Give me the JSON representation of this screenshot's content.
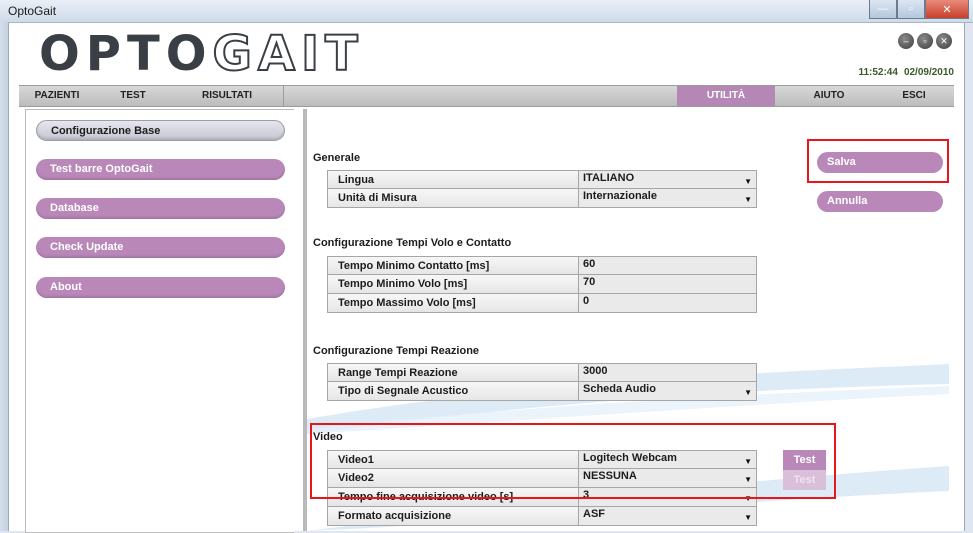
{
  "window": {
    "title": "OptoGait",
    "min_label": "—",
    "max_label": "▫",
    "close_label": "✕"
  },
  "header": {
    "logo_left": "OPTO",
    "logo_right": "GAIT",
    "time": "11:52:44",
    "date": "02/09/2010",
    "circle_icons": [
      "minimize-circle-icon",
      "restore-circle-icon",
      "close-circle-icon"
    ]
  },
  "menu": {
    "pazienti": "PAZIENTI",
    "test": "TEST",
    "risultati": "RISULTATI",
    "utilita": "UTILITÀ",
    "aiuto": "AIUTO",
    "esci": "ESCI"
  },
  "sidebar": {
    "items": [
      "Configurazione Base",
      "Test barre OptoGait",
      "Database",
      "Check Update",
      "About"
    ],
    "selected": "Configurazione Base"
  },
  "general": {
    "title": "Generale",
    "lingua_label": "Lingua",
    "lingua_value": "ITALIANO",
    "unita_label": "Unità di Misura",
    "unita_value": "Internazionale"
  },
  "tempi": {
    "title": "Configurazione Tempi Volo e Contatto",
    "min_contatto_label": "Tempo Minimo Contatto [ms]",
    "min_contatto_value": "60",
    "min_volo_label": "Tempo Minimo Volo [ms]",
    "min_volo_value": "70",
    "max_volo_label": "Tempo Massimo Volo [ms]",
    "max_volo_value": "0"
  },
  "reazione": {
    "title": "Configurazione Tempi Reazione",
    "range_label": "Range Tempi Reazione",
    "range_value": "3000",
    "segnale_label": "Tipo di Segnale Acustico",
    "segnale_value": "Scheda Audio"
  },
  "video": {
    "title": "Video",
    "video1_label": "Video1",
    "video1_value": "Logitech Webcam",
    "video2_label": "Video2",
    "video2_value": "NESSUNA",
    "tempo_fine_label": "Tempo fine acquisizione video [s]",
    "tempo_fine_value": "3",
    "formato_label": "Formato acquisizione",
    "formato_value": "ASF",
    "test_label": "Test"
  },
  "actions": {
    "salva": "Salva",
    "annulla": "Annulla"
  },
  "colors": {
    "accent": "#b988b9",
    "highlight": "#e8151b"
  }
}
